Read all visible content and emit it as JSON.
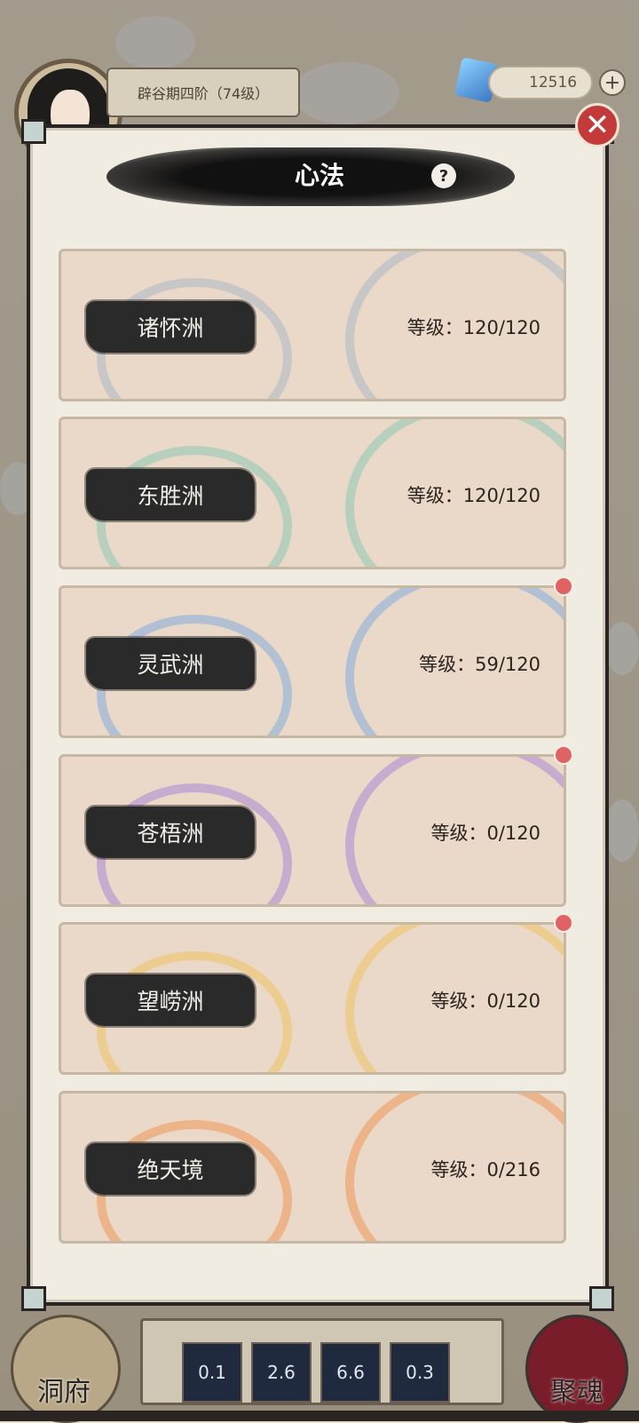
{
  "header": {
    "realm_label": "辟谷期四阶（74级）",
    "currency_value": "12516",
    "plus_symbol": "+"
  },
  "modal": {
    "title": "心法",
    "help_symbol": "?",
    "close_symbol": "✕",
    "cards": [
      {
        "name": "诸怀洲",
        "level": "等级：120/120",
        "color": "#9fb4c7",
        "dot": false
      },
      {
        "name": "东胜洲",
        "level": "等级：120/120",
        "color": "#79c7b0",
        "dot": false
      },
      {
        "name": "灵武洲",
        "level": "等级：59/120",
        "color": "#6fa4e0",
        "dot": true
      },
      {
        "name": "苍梧洲",
        "level": "等级：0/120",
        "color": "#9b7ad8",
        "dot": true
      },
      {
        "name": "望崂洲",
        "level": "等级：0/120",
        "color": "#f0c24a",
        "dot": true
      },
      {
        "name": "绝天境",
        "level": "等级：0/216",
        "color": "#ef8a3a",
        "dot": false
      }
    ]
  },
  "bottom": {
    "home_label": "洞府",
    "soul_label": "聚魂",
    "skills": [
      "0.1",
      "2.6",
      "6.6",
      "0.3"
    ]
  }
}
